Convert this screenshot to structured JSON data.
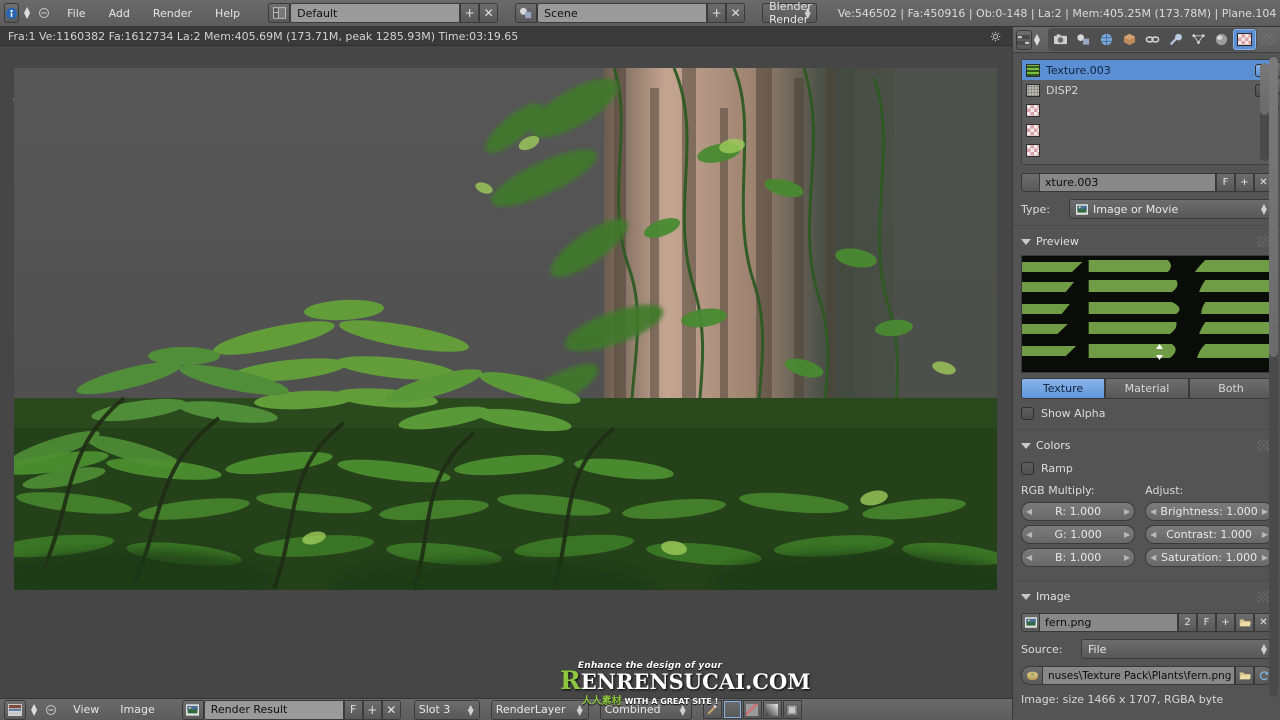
{
  "topbar": {
    "logo_icon": "blender-logo-icon",
    "collapse_icon": "collapse-menu-icon",
    "menus": [
      "File",
      "Add",
      "Render",
      "Help"
    ],
    "layout_icon": "screen-layout-icon",
    "layout_value": "Default",
    "scene_icon": "scene-icon",
    "scene_value": "Scene",
    "engine_value": "Blender Render",
    "stats": "Ve:546502 | Fa:450916 | Ob:0-148 | La:2 | Mem:405.25M (173.78M) | Plane.104",
    "maximize_icon": "maximize-icon",
    "add_icon": "plus-icon",
    "unlink_icon": "unlink-x-icon"
  },
  "image_editor": {
    "render_info": "Fra:1  Ve:1160382 Fa:1612734 La:2 Mem:405.69M (173.71M, peak 1285.93M) Time:03:19.65",
    "settings_icon": "gear-icon",
    "cursor_icon": "image-cursor-icon"
  },
  "bottombar": {
    "editor_icon": "image-editor-icon",
    "collapse_icon": "collapse-menu-icon",
    "menus": [
      "View",
      "Image"
    ],
    "image_icon": "image-datablock-icon",
    "image_name": "Render Result",
    "fake_user": "F",
    "add_icon": "plus-icon",
    "unlink_icon": "unlink-x-icon",
    "slot": "Slot 3",
    "layer": "RenderLayer",
    "pass": "Combined",
    "brush_icon": "paint-brush-icon",
    "alpha_icon": "checker-alpha-icon",
    "zebra_icon": "zebra-icon",
    "gradient_icon": "gradient-icon",
    "display_icon": "display-channel-icon"
  },
  "properties": {
    "context_icons": [
      "render-icon",
      "scene-icon",
      "world-icon",
      "object-icon",
      "constraints-icon",
      "modifier-wrench-icon",
      "object-data-icon",
      "material-icon",
      "texture-icon"
    ],
    "active_context": "texture-icon",
    "browse_icon": "browse-datablock-icon",
    "texture_list": [
      {
        "name": "Texture.003",
        "icon": "leaf-texture-icon",
        "selected": true,
        "enabled": true
      },
      {
        "name": "DISP2",
        "icon": "displacement-texture-icon",
        "selected": false,
        "enabled": false
      },
      {
        "name": "",
        "icon": "empty-checker-icon",
        "selected": false,
        "enabled": false
      },
      {
        "name": "",
        "icon": "empty-checker-icon",
        "selected": false,
        "enabled": false
      },
      {
        "name": "",
        "icon": "empty-checker-icon",
        "selected": false,
        "enabled": false
      }
    ],
    "list_buttons": [
      "move-up-icon",
      "move-down-icon",
      "specials-menu-icon"
    ],
    "datablock": {
      "icon": "texture-icon",
      "name": "xture.003",
      "fake_user": "F",
      "new_icon": "plus-icon",
      "delete_icon": "unlink-x-icon"
    },
    "type_label": "Type:",
    "type_value": "Image or Movie",
    "type_icon": "image-icon",
    "preview": {
      "title": "Preview",
      "buttons": [
        "Texture",
        "Material",
        "Both"
      ],
      "active_button": "Texture",
      "show_alpha_label": "Show Alpha",
      "show_alpha_checked": false
    },
    "colors": {
      "title": "Colors",
      "ramp_label": "Ramp",
      "ramp_checked": false,
      "rgb_multiply_label": "RGB Multiply:",
      "adjust_label": "Adjust:",
      "rgb": [
        {
          "label": "R: 1.000"
        },
        {
          "label": "G: 1.000"
        },
        {
          "label": "B: 1.000"
        }
      ],
      "adjust": [
        {
          "label": "Brightness: 1.000"
        },
        {
          "label": "Contrast: 1.000"
        },
        {
          "label": "Saturation: 1.000"
        }
      ]
    },
    "image": {
      "title": "Image",
      "icon": "image-datablock-icon",
      "name": "fern.png",
      "users": "2",
      "fake_user": "F",
      "new_icon": "plus-icon",
      "open_icon": "folder-open-icon",
      "unlink_icon": "unlink-x-icon",
      "source_label": "Source:",
      "source_value": "File",
      "path_icon": "file-image-icon",
      "path_value": "nuses\\Texture Pack\\Plants\\fern.png",
      "path_browse_icon": "folder-open-icon",
      "reload_icon": "reload-icon",
      "info": "Image: size 1466 x 1707, RGBA byte"
    }
  },
  "watermark": {
    "line1": "Enhance the design of your",
    "brand_r": "R",
    "brand_rest": "ENRENSUCAI.COM",
    "cn": "人人素材",
    "line3": "WITH A GREAT SITE !"
  },
  "colors": {
    "accent": "#5b8fd4",
    "panel_bg": "#545454",
    "header_bg": "#5d5d5d",
    "viewport_bg": "#464646",
    "green": "#8dc63f"
  }
}
